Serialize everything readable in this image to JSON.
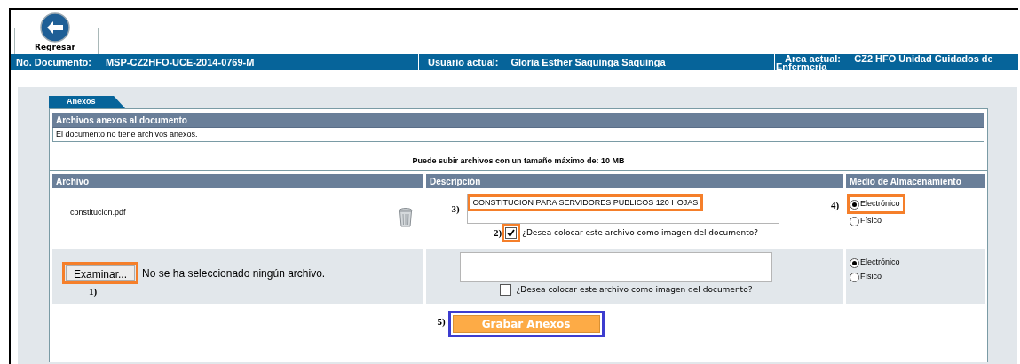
{
  "back_button": {
    "label": "Regresar"
  },
  "info_bar": {
    "document_label": "No. Documento:",
    "document_value": "MSP-CZ2HFO-UCE-2014-0769-M",
    "user_label": "Usuario actual:",
    "user_value": "Gloria Esther Saquinga Saquinga",
    "area_label": "Area actual:",
    "area_value": "CZ2 HFO Unidad Cuidados de Enfermería"
  },
  "tabs": [
    {
      "label": "Anexos",
      "selected": true
    }
  ],
  "attachments_section": {
    "title": "Archivos anexos al documento",
    "message": "El documento no tiene archivos anexos."
  },
  "size_note": "Puede subir archivos con un tamaño máximo de: 10 MB",
  "table": {
    "columns": [
      "Archivo",
      "Descripción",
      "Medio de Almacenamiento"
    ],
    "rows": [
      {
        "kind": "file",
        "file_name": "constitucion.pdf",
        "description": "CONSTITUCION PARA SERVIDORES PUBLICOS 120 HOJAS",
        "description_marker": "3)",
        "image_checkbox": {
          "label": "¿Desea colocar este archivo como imagen del documento?",
          "checked": true,
          "marker": "2)"
        },
        "storage": [
          {
            "label": "Electrónico",
            "selected": true
          },
          {
            "label": "Físico",
            "selected": false
          }
        ],
        "storage_marker": "4)"
      },
      {
        "kind": "upload",
        "browse_button": "Examinar...",
        "browse_marker": "1)",
        "file_status": "No se ha seleccionado ningún archivo.",
        "image_checkbox": {
          "label": "¿Desea colocar este archivo como imagen del documento?",
          "checked": false
        },
        "storage": [
          {
            "label": "Electrónico",
            "selected": true
          },
          {
            "label": "Físico",
            "selected": false
          }
        ]
      }
    ]
  },
  "save_button": {
    "label": "Grabar Anexos",
    "marker": "5)"
  }
}
